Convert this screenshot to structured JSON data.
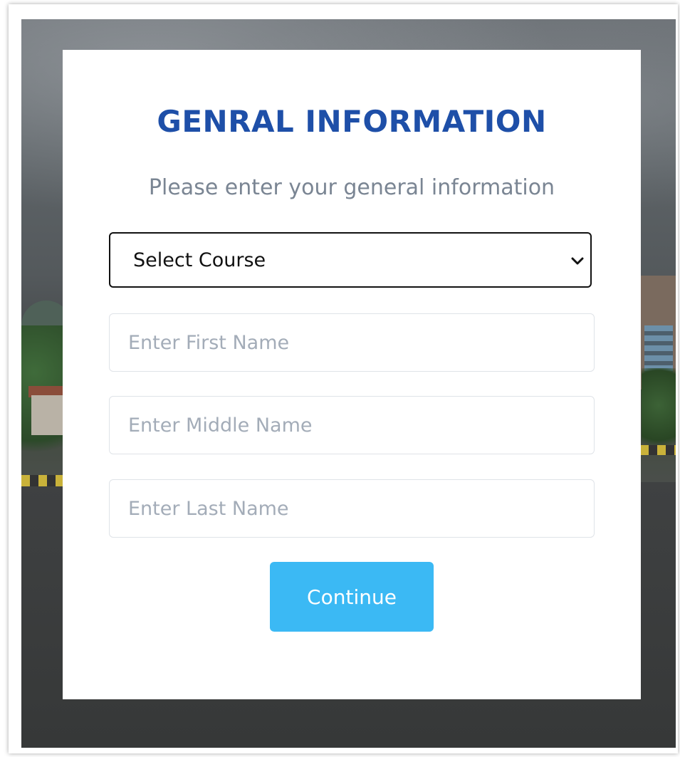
{
  "form": {
    "title": "GENRAL INFORMATION",
    "subtitle": "Please enter your general information",
    "course_select": {
      "selected": "Select Course",
      "icon": "chevron-down-icon"
    },
    "first_name": {
      "placeholder": "Enter First Name",
      "value": ""
    },
    "middle_name": {
      "placeholder": "Enter Middle Name",
      "value": ""
    },
    "last_name": {
      "placeholder": "Enter Last Name",
      "value": ""
    },
    "continue_label": "Continue"
  },
  "colors": {
    "title": "#1e4fa8",
    "subtitle": "#7a8593",
    "button": "#3bb9f4",
    "placeholder": "#a3acb8",
    "field_border": "#dfe3e8"
  }
}
